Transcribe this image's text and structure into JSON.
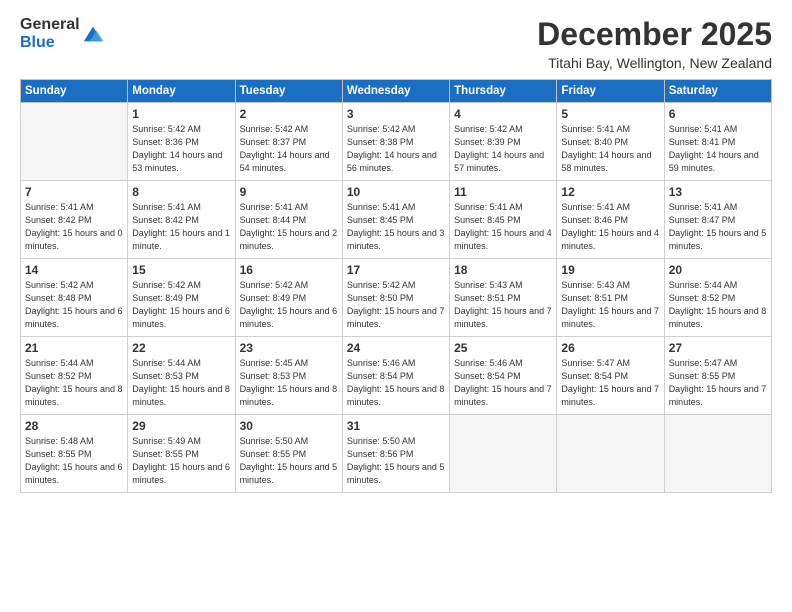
{
  "logo": {
    "general": "General",
    "blue": "Blue"
  },
  "title": "December 2025",
  "subtitle": "Titahi Bay, Wellington, New Zealand",
  "days_header": [
    "Sunday",
    "Monday",
    "Tuesday",
    "Wednesday",
    "Thursday",
    "Friday",
    "Saturday"
  ],
  "weeks": [
    [
      {
        "num": "",
        "empty": true
      },
      {
        "num": "1",
        "rise": "5:42 AM",
        "set": "8:36 PM",
        "daylight": "14 hours and 53 minutes."
      },
      {
        "num": "2",
        "rise": "5:42 AM",
        "set": "8:37 PM",
        "daylight": "14 hours and 54 minutes."
      },
      {
        "num": "3",
        "rise": "5:42 AM",
        "set": "8:38 PM",
        "daylight": "14 hours and 56 minutes."
      },
      {
        "num": "4",
        "rise": "5:42 AM",
        "set": "8:39 PM",
        "daylight": "14 hours and 57 minutes."
      },
      {
        "num": "5",
        "rise": "5:41 AM",
        "set": "8:40 PM",
        "daylight": "14 hours and 58 minutes."
      },
      {
        "num": "6",
        "rise": "5:41 AM",
        "set": "8:41 PM",
        "daylight": "14 hours and 59 minutes."
      }
    ],
    [
      {
        "num": "7",
        "rise": "5:41 AM",
        "set": "8:42 PM",
        "daylight": "15 hours and 0 minutes."
      },
      {
        "num": "8",
        "rise": "5:41 AM",
        "set": "8:42 PM",
        "daylight": "15 hours and 1 minute."
      },
      {
        "num": "9",
        "rise": "5:41 AM",
        "set": "8:44 PM",
        "daylight": "15 hours and 2 minutes."
      },
      {
        "num": "10",
        "rise": "5:41 AM",
        "set": "8:45 PM",
        "daylight": "15 hours and 3 minutes."
      },
      {
        "num": "11",
        "rise": "5:41 AM",
        "set": "8:45 PM",
        "daylight": "15 hours and 4 minutes."
      },
      {
        "num": "12",
        "rise": "5:41 AM",
        "set": "8:46 PM",
        "daylight": "15 hours and 4 minutes."
      },
      {
        "num": "13",
        "rise": "5:41 AM",
        "set": "8:47 PM",
        "daylight": "15 hours and 5 minutes."
      }
    ],
    [
      {
        "num": "14",
        "rise": "5:42 AM",
        "set": "8:48 PM",
        "daylight": "15 hours and 6 minutes."
      },
      {
        "num": "15",
        "rise": "5:42 AM",
        "set": "8:49 PM",
        "daylight": "15 hours and 6 minutes."
      },
      {
        "num": "16",
        "rise": "5:42 AM",
        "set": "8:49 PM",
        "daylight": "15 hours and 6 minutes."
      },
      {
        "num": "17",
        "rise": "5:42 AM",
        "set": "8:50 PM",
        "daylight": "15 hours and 7 minutes."
      },
      {
        "num": "18",
        "rise": "5:43 AM",
        "set": "8:51 PM",
        "daylight": "15 hours and 7 minutes."
      },
      {
        "num": "19",
        "rise": "5:43 AM",
        "set": "8:51 PM",
        "daylight": "15 hours and 7 minutes."
      },
      {
        "num": "20",
        "rise": "5:44 AM",
        "set": "8:52 PM",
        "daylight": "15 hours and 8 minutes."
      }
    ],
    [
      {
        "num": "21",
        "rise": "5:44 AM",
        "set": "8:52 PM",
        "daylight": "15 hours and 8 minutes."
      },
      {
        "num": "22",
        "rise": "5:44 AM",
        "set": "8:53 PM",
        "daylight": "15 hours and 8 minutes."
      },
      {
        "num": "23",
        "rise": "5:45 AM",
        "set": "8:53 PM",
        "daylight": "15 hours and 8 minutes."
      },
      {
        "num": "24",
        "rise": "5:46 AM",
        "set": "8:54 PM",
        "daylight": "15 hours and 8 minutes."
      },
      {
        "num": "25",
        "rise": "5:46 AM",
        "set": "8:54 PM",
        "daylight": "15 hours and 7 minutes."
      },
      {
        "num": "26",
        "rise": "5:47 AM",
        "set": "8:54 PM",
        "daylight": "15 hours and 7 minutes."
      },
      {
        "num": "27",
        "rise": "5:47 AM",
        "set": "8:55 PM",
        "daylight": "15 hours and 7 minutes."
      }
    ],
    [
      {
        "num": "28",
        "rise": "5:48 AM",
        "set": "8:55 PM",
        "daylight": "15 hours and 6 minutes."
      },
      {
        "num": "29",
        "rise": "5:49 AM",
        "set": "8:55 PM",
        "daylight": "15 hours and 6 minutes."
      },
      {
        "num": "30",
        "rise": "5:50 AM",
        "set": "8:55 PM",
        "daylight": "15 hours and 5 minutes."
      },
      {
        "num": "31",
        "rise": "5:50 AM",
        "set": "8:56 PM",
        "daylight": "15 hours and 5 minutes."
      },
      {
        "num": "",
        "empty": true
      },
      {
        "num": "",
        "empty": true
      },
      {
        "num": "",
        "empty": true
      }
    ]
  ],
  "labels": {
    "sunrise": "Sunrise:",
    "sunset": "Sunset:",
    "daylight": "Daylight:"
  }
}
